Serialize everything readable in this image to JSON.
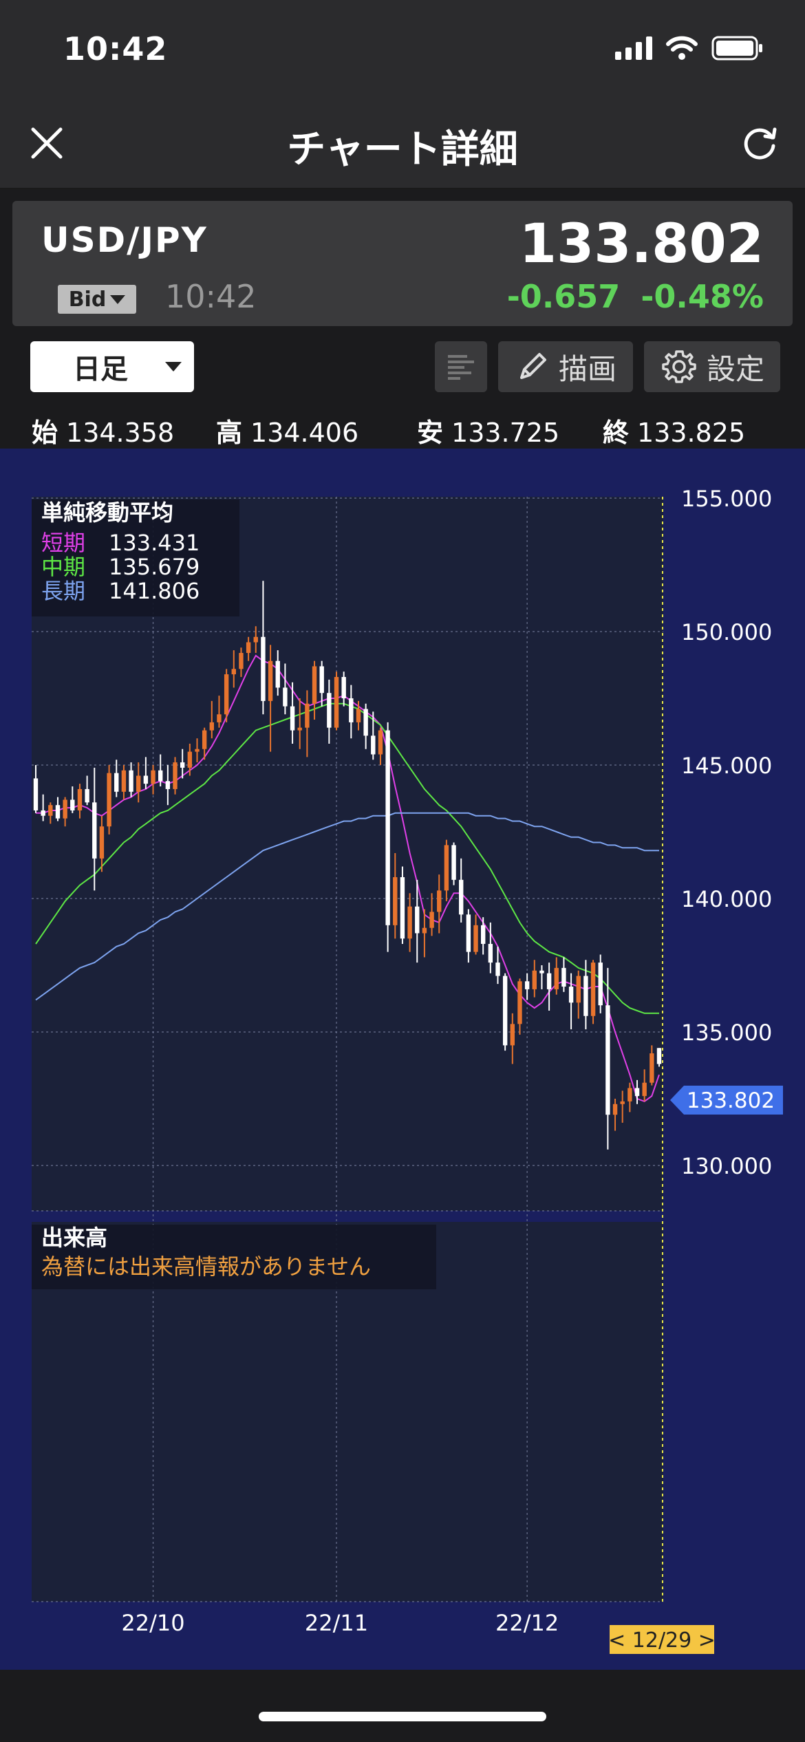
{
  "status_bar": {
    "time": "10:42"
  },
  "nav": {
    "title": "チャート詳細"
  },
  "quote": {
    "pair": "USD/JPY",
    "rate_type": "Bid",
    "time": "10:42",
    "price": "133.802",
    "change": "-0.657",
    "change_pct": "-0.48%"
  },
  "controls": {
    "period": "日足",
    "draw_label": "描画",
    "settings_label": "設定"
  },
  "ohlc": {
    "open_label": "始",
    "open": "134.358",
    "high_label": "高",
    "high": "134.406",
    "low_label": "安",
    "low": "133.725",
    "close_label": "終",
    "close": "133.825"
  },
  "sma_legend": {
    "title": "単純移動平均",
    "short_label": "短期",
    "short_value": "133.431",
    "mid_label": "中期",
    "mid_value": "135.679",
    "long_label": "長期",
    "long_value": "141.806"
  },
  "volume_panel": {
    "title": "出来高",
    "note": "為替には出来高情報がありません"
  },
  "colors": {
    "up_candle": "#e8742e",
    "down_candle": "#ffffff",
    "sma_short": "#e040e8",
    "sma_mid": "#5ee845",
    "sma_long": "#7ea4f0",
    "price_tag": "#3f6fe8",
    "date_tag": "#f5c542",
    "change_positive_green": "#5fd35a"
  },
  "chart_data": {
    "type": "candlestick",
    "pair": "USD/JPY",
    "timeframe": "日足",
    "ylim": [
      130.0,
      155.0
    ],
    "yticks": [
      "155.000",
      "150.000",
      "145.000",
      "140.000",
      "135.000",
      "130.000"
    ],
    "xticks": [
      "22/10",
      "22/11",
      "22/12"
    ],
    "current_price_label": "133.802",
    "cursor_date_label": "< 12/29 >",
    "grid": true,
    "candles": [
      [
        144.5,
        145.0,
        143.2,
        143.3
      ],
      [
        143.3,
        143.9,
        142.9,
        143.1
      ],
      [
        143.1,
        143.6,
        142.8,
        143.5
      ],
      [
        143.5,
        143.8,
        142.9,
        143.0
      ],
      [
        143.0,
        143.8,
        142.7,
        143.7
      ],
      [
        143.7,
        144.2,
        143.2,
        143.3
      ],
      [
        143.3,
        144.3,
        143.0,
        144.1
      ],
      [
        144.1,
        144.6,
        143.5,
        143.6
      ],
      [
        143.6,
        144.9,
        140.3,
        141.5
      ],
      [
        141.5,
        143.1,
        141.0,
        142.7
      ],
      [
        142.7,
        145.0,
        142.4,
        144.7
      ],
      [
        144.7,
        145.2,
        143.8,
        144.0
      ],
      [
        144.0,
        145.0,
        143.7,
        144.8
      ],
      [
        144.8,
        145.1,
        143.8,
        144.0
      ],
      [
        144.0,
        145.1,
        143.6,
        144.6
      ],
      [
        144.6,
        145.3,
        144.1,
        144.3
      ],
      [
        144.3,
        145.0,
        143.9,
        144.8
      ],
      [
        144.8,
        145.4,
        144.2,
        144.4
      ],
      [
        144.4,
        145.0,
        143.5,
        144.1
      ],
      [
        144.1,
        145.3,
        143.9,
        145.1
      ],
      [
        145.1,
        145.6,
        144.5,
        144.9
      ],
      [
        144.9,
        145.8,
        144.6,
        145.5
      ],
      [
        145.5,
        146.0,
        145.1,
        145.6
      ],
      [
        145.6,
        146.4,
        145.2,
        146.3
      ],
      [
        146.3,
        147.4,
        146.0,
        146.6
      ],
      [
        146.6,
        147.6,
        146.4,
        146.9
      ],
      [
        146.9,
        148.6,
        146.6,
        148.4
      ],
      [
        148.4,
        149.3,
        147.9,
        148.6
      ],
      [
        148.6,
        149.4,
        148.3,
        149.2
      ],
      [
        149.2,
        149.8,
        148.9,
        149.6
      ],
      [
        149.6,
        150.2,
        149.2,
        149.8
      ],
      [
        149.8,
        151.9,
        146.9,
        147.4
      ],
      [
        147.4,
        149.5,
        145.5,
        148.9
      ],
      [
        148.9,
        149.3,
        147.6,
        147.9
      ],
      [
        147.9,
        148.8,
        146.9,
        147.2
      ],
      [
        147.2,
        148.1,
        145.8,
        146.3
      ],
      [
        146.3,
        147.5,
        145.6,
        146.4
      ],
      [
        146.4,
        147.8,
        145.3,
        147.3
      ],
      [
        147.3,
        148.9,
        146.7,
        148.7
      ],
      [
        148.7,
        148.9,
        147.2,
        147.7
      ],
      [
        147.7,
        148.2,
        145.8,
        146.4
      ],
      [
        146.4,
        148.5,
        146.3,
        148.3
      ],
      [
        148.3,
        148.5,
        147.2,
        147.5
      ],
      [
        147.5,
        148.0,
        146.0,
        146.6
      ],
      [
        146.6,
        147.4,
        146.3,
        147.1
      ],
      [
        147.1,
        147.3,
        145.6,
        146.1
      ],
      [
        146.1,
        147.0,
        145.2,
        145.4
      ],
      [
        145.4,
        146.4,
        145.0,
        146.3
      ],
      [
        146.3,
        146.6,
        138.0,
        139.0
      ],
      [
        139.0,
        141.7,
        138.5,
        140.8
      ],
      [
        140.8,
        141.2,
        138.3,
        138.5
      ],
      [
        138.5,
        140.2,
        138.0,
        139.7
      ],
      [
        139.7,
        140.7,
        137.6,
        138.7
      ],
      [
        138.7,
        139.6,
        137.8,
        138.9
      ],
      [
        138.9,
        140.2,
        138.6,
        139.5
      ],
      [
        139.5,
        140.9,
        138.7,
        140.3
      ],
      [
        140.3,
        142.2,
        139.9,
        142.0
      ],
      [
        142.0,
        142.1,
        140.5,
        140.7
      ],
      [
        140.7,
        141.5,
        139.1,
        139.4
      ],
      [
        139.4,
        139.6,
        137.6,
        138.0
      ],
      [
        138.0,
        139.4,
        137.9,
        139.0
      ],
      [
        139.0,
        139.3,
        137.9,
        138.3
      ],
      [
        138.3,
        139.1,
        137.2,
        137.6
      ],
      [
        137.6,
        138.2,
        136.8,
        137.1
      ],
      [
        137.1,
        137.2,
        134.3,
        134.5
      ],
      [
        134.5,
        135.7,
        133.8,
        135.3
      ],
      [
        135.3,
        137.0,
        134.9,
        136.9
      ],
      [
        136.9,
        137.2,
        136.2,
        136.6
      ],
      [
        136.6,
        137.7,
        136.3,
        137.3
      ],
      [
        137.3,
        137.5,
        136.6,
        137.2
      ],
      [
        137.2,
        137.6,
        135.8,
        136.6
      ],
      [
        136.6,
        137.8,
        136.4,
        137.4
      ],
      [
        137.4,
        137.8,
        136.5,
        136.7
      ],
      [
        136.7,
        137.2,
        135.1,
        136.1
      ],
      [
        136.1,
        137.3,
        135.5,
        137.1
      ],
      [
        137.1,
        137.7,
        135.1,
        135.6
      ],
      [
        135.6,
        137.7,
        135.3,
        137.6
      ],
      [
        137.6,
        137.9,
        135.7,
        136.0
      ],
      [
        136.0,
        137.4,
        130.6,
        131.9
      ],
      [
        131.9,
        132.5,
        131.3,
        132.3
      ],
      [
        132.3,
        132.8,
        131.6,
        132.4
      ],
      [
        132.4,
        133.1,
        132.0,
        132.9
      ],
      [
        132.9,
        133.2,
        132.3,
        132.6
      ],
      [
        132.6,
        133.6,
        132.4,
        133.1
      ],
      [
        133.1,
        134.5,
        133.0,
        134.2
      ],
      [
        134.4,
        134.4,
        133.7,
        133.8
      ]
    ],
    "series": [
      {
        "name": "短期",
        "values": [
          143.2,
          143.2,
          143.3,
          143.3,
          143.4,
          143.4,
          143.5,
          143.4,
          143.2,
          143.1,
          143.3,
          143.5,
          143.7,
          143.8,
          144.0,
          144.1,
          144.3,
          144.4,
          144.3,
          144.4,
          144.6,
          144.8,
          145.0,
          145.3,
          145.7,
          146.2,
          146.8,
          147.4,
          148.0,
          148.6,
          149.1,
          148.9,
          148.8,
          148.6,
          148.2,
          147.8,
          147.4,
          147.2,
          147.3,
          147.4,
          147.5,
          147.5,
          147.6,
          147.4,
          147.2,
          147.0,
          146.8,
          146.5,
          145.5,
          144.2,
          143.0,
          141.7,
          140.6,
          139.4,
          139.2,
          139.1,
          139.7,
          140.2,
          140.2,
          139.9,
          139.5,
          139.1,
          138.7,
          138.2,
          137.5,
          136.8,
          136.4,
          136.1,
          135.9,
          136.1,
          136.5,
          136.8,
          136.9,
          136.8,
          136.7,
          136.6,
          136.7,
          136.7,
          135.9,
          135.0,
          134.2,
          133.4,
          132.5,
          132.4,
          132.6,
          133.4
        ]
      },
      {
        "name": "中期",
        "values": [
          138.3,
          138.7,
          139.1,
          139.5,
          139.9,
          140.2,
          140.5,
          140.7,
          140.9,
          141.2,
          141.5,
          141.8,
          142.1,
          142.3,
          142.6,
          142.8,
          143.0,
          143.2,
          143.3,
          143.5,
          143.7,
          143.9,
          144.1,
          144.3,
          144.6,
          144.8,
          145.1,
          145.4,
          145.7,
          146.0,
          146.3,
          146.4,
          146.5,
          146.6,
          146.7,
          146.8,
          146.9,
          147.0,
          147.1,
          147.2,
          147.3,
          147.3,
          147.3,
          147.2,
          147.1,
          146.9,
          146.7,
          146.5,
          146.1,
          145.7,
          145.3,
          144.9,
          144.5,
          144.1,
          143.8,
          143.5,
          143.3,
          143.0,
          142.7,
          142.3,
          141.9,
          141.5,
          141.1,
          140.6,
          140.1,
          139.6,
          139.1,
          138.7,
          138.4,
          138.2,
          138.0,
          137.9,
          137.8,
          137.6,
          137.4,
          137.3,
          137.2,
          137.0,
          136.7,
          136.4,
          136.1,
          135.9,
          135.8,
          135.7,
          135.7,
          135.7
        ]
      },
      {
        "name": "長期",
        "values": [
          136.2,
          136.4,
          136.6,
          136.8,
          137.0,
          137.2,
          137.4,
          137.5,
          137.6,
          137.8,
          138.0,
          138.2,
          138.3,
          138.5,
          138.7,
          138.8,
          139.0,
          139.2,
          139.3,
          139.5,
          139.6,
          139.8,
          140.0,
          140.2,
          140.4,
          140.6,
          140.8,
          141.0,
          141.2,
          141.4,
          141.6,
          141.8,
          141.9,
          142.0,
          142.1,
          142.2,
          142.3,
          142.4,
          142.5,
          142.6,
          142.7,
          142.8,
          142.9,
          142.9,
          143.0,
          143.0,
          143.1,
          143.1,
          143.1,
          143.2,
          143.2,
          143.2,
          143.2,
          143.2,
          143.2,
          143.2,
          143.2,
          143.2,
          143.2,
          143.2,
          143.1,
          143.1,
          143.1,
          143.0,
          143.0,
          142.9,
          142.9,
          142.8,
          142.7,
          142.7,
          142.6,
          142.5,
          142.4,
          142.3,
          142.3,
          142.2,
          142.1,
          142.1,
          142.0,
          142.0,
          141.9,
          141.9,
          141.9,
          141.8,
          141.8,
          141.8
        ]
      }
    ]
  }
}
